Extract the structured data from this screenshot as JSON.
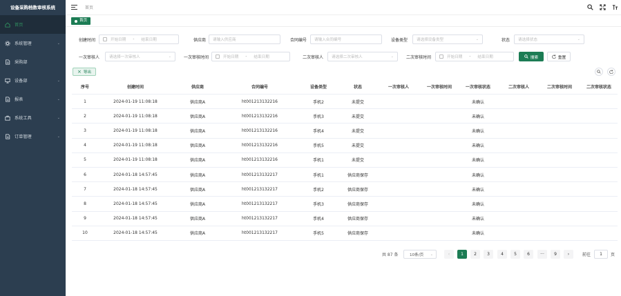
{
  "app": {
    "title": "设备采购档数审核系统"
  },
  "sidebar": {
    "items": [
      {
        "label": "首页",
        "icon": "home-icon",
        "active": true,
        "chevron": false
      },
      {
        "label": "系统管理",
        "icon": "gear-icon",
        "chevron": true
      },
      {
        "label": "采购部",
        "icon": "document-icon",
        "chevron": false
      },
      {
        "label": "设备部",
        "icon": "monitor-icon",
        "chevron": true
      },
      {
        "label": "报表",
        "icon": "document-icon",
        "chevron": true
      },
      {
        "label": "系统工具",
        "icon": "toolbox-icon",
        "chevron": true
      },
      {
        "label": "订单管理",
        "icon": "document-icon",
        "chevron": true
      }
    ]
  },
  "header": {
    "breadcrumb": "首页"
  },
  "tabs": {
    "home": "首页"
  },
  "filters": {
    "created_time_label": "创建时间",
    "start_placeholder": "开始日期",
    "end_placeholder": "结束日期",
    "range_sep": "-",
    "supplier_label": "供应商",
    "supplier_placeholder": "请输入供应商",
    "contract_label": "合同编号",
    "contract_placeholder": "请输入合同编号",
    "device_type_label": "设备类型",
    "device_type_placeholder": "请选择设备类型",
    "status_label": "状态",
    "status_placeholder": "请选择状态",
    "reviewer1_label": "一次审核人",
    "reviewer1_placeholder": "请选择一次审核人",
    "review1_time_label": "一次审核时间",
    "reviewer2_label": "二次审核人",
    "reviewer2_placeholder": "请选择二次审核人",
    "review2_time_label": "二次审核时间",
    "search_label": "搜索",
    "reset_label": "重置"
  },
  "toolbar": {
    "export_label": "导出"
  },
  "table": {
    "columns": [
      "序号",
      "创建时间",
      "供应商",
      "合同编号",
      "设备类型",
      "状态",
      "一次审核人",
      "一次审核时间",
      "一次审核状态",
      "二次审核人",
      "二次审核时间",
      "二次审核状态"
    ],
    "rows": [
      [
        "1",
        "2024-01-19 11:08:18",
        "供应商A",
        "ht001213132216",
        "手机2",
        "未提交",
        "",
        "",
        "未确认",
        "",
        "",
        ""
      ],
      [
        "2",
        "2024-01-19 11:08:18",
        "供应商A",
        "ht001213132216",
        "手机3",
        "未提交",
        "",
        "",
        "未确认",
        "",
        "",
        ""
      ],
      [
        "3",
        "2024-01-19 11:08:18",
        "供应商A",
        "ht001213132216",
        "手机4",
        "未提交",
        "",
        "",
        "未确认",
        "",
        "",
        ""
      ],
      [
        "4",
        "2024-01-19 11:08:18",
        "供应商A",
        "ht001213132216",
        "手机5",
        "未提交",
        "",
        "",
        "未确认",
        "",
        "",
        ""
      ],
      [
        "5",
        "2024-01-19 11:08:18",
        "供应商A",
        "ht001213132216",
        "手机1",
        "未提交",
        "",
        "",
        "未确认",
        "",
        "",
        ""
      ],
      [
        "6",
        "2024-01-18 14:57:45",
        "供应商A",
        "ht001213132217",
        "手机1",
        "供应商保存",
        "",
        "",
        "未确认",
        "",
        "",
        ""
      ],
      [
        "7",
        "2024-01-18 14:57:45",
        "供应商A",
        "ht001213132217",
        "手机2",
        "供应商保存",
        "",
        "",
        "未确认",
        "",
        "",
        ""
      ],
      [
        "8",
        "2024-01-18 14:57:45",
        "供应商A",
        "ht001213132217",
        "手机3",
        "供应商保存",
        "",
        "",
        "未确认",
        "",
        "",
        ""
      ],
      [
        "9",
        "2024-01-18 14:57:45",
        "供应商A",
        "ht001213132217",
        "手机4",
        "供应商保存",
        "",
        "",
        "未确认",
        "",
        "",
        ""
      ],
      [
        "10",
        "2024-01-18 14:57:45",
        "供应商A",
        "ht001213132217",
        "手机5",
        "供应商保存",
        "",
        "",
        "未确认",
        "",
        "",
        ""
      ]
    ]
  },
  "pagination": {
    "total": "共 87 条",
    "page_size": "10条/页",
    "pages": [
      "1",
      "2",
      "3",
      "4",
      "5",
      "6",
      "···",
      "9"
    ],
    "current": "1",
    "goto_label": "前往",
    "goto_value": "1",
    "page_unit": "页"
  },
  "colors": {
    "sidebar_bg": "#2c3e50",
    "accent": "#1c7c54"
  }
}
